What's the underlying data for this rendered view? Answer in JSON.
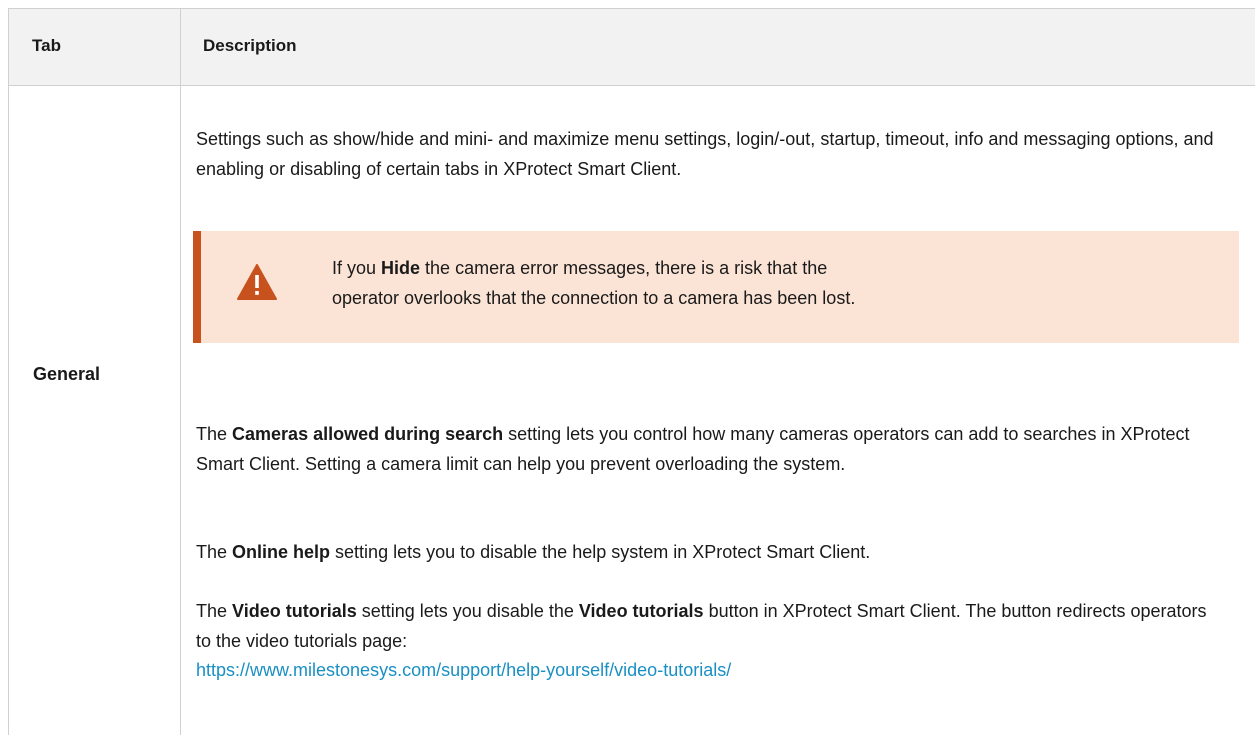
{
  "table": {
    "headers": {
      "tab": "Tab",
      "description": "Description"
    },
    "row": {
      "tab": "General",
      "p1": "Settings such as show/hide and mini- and maximize menu settings, login/-out, startup, timeout, info and messaging options, and enabling or disabling of certain tabs in XProtect Smart Client.",
      "note": {
        "icon": "warning-icon",
        "pre": "If you ",
        "bold": "Hide",
        "post_line1": " the camera error messages, there is a risk that the",
        "line2": "operator overlooks that the connection to a camera has been lost."
      },
      "p2": {
        "pre": "The ",
        "bold": "Cameras allowed during search",
        "post": " setting lets you control how many cameras operators can add to searches in XProtect Smart Client. Setting a camera limit can help you prevent overloading the system."
      },
      "p3": {
        "pre": "The ",
        "bold": "Online help",
        "post": " setting lets you to disable the help system in XProtect Smart Client."
      },
      "p4": {
        "pre": "The ",
        "bold1": "Video tutorials",
        "mid": " setting lets you disable the ",
        "bold2": "Video tutorials",
        "post": " button in XProtect Smart Client. The button redirects operators to the video tutorials page:",
        "link": "https://www.milestonesys.com/support/help-yourself/video-tutorials/"
      }
    }
  },
  "colors": {
    "note_bg": "#fbe4d6",
    "note_accent": "#c8521d",
    "link": "#1a8fc4"
  }
}
